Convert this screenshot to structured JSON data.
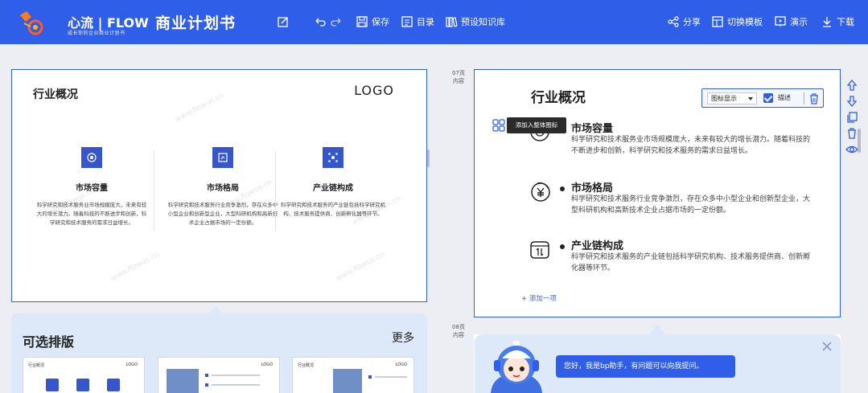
{
  "topbar": {
    "logo_text": "心流 | FLOW",
    "logo_subtitle": "成长你的企业商业计划书",
    "doc_title": "商业计划书",
    "save_label": "保存",
    "toc_label": "目录",
    "knowledge_label": "预设知识库",
    "share_label": "分享",
    "switch_template_label": "切换模板",
    "present_label": "演示",
    "download_label": "下载"
  },
  "left_slide": {
    "title": "行业概况",
    "logo": "LOGO",
    "columns": [
      {
        "heading": "市场容量",
        "text": "科学研究和技术服务业市场规模庞大，未来有较大的增长潜力。随着科技的不断进步和创新，科学研究和技术服务的需求日益增长。"
      },
      {
        "heading": "市场格局",
        "text": "科学研究和技术服务行业竞争激烈，存在众多中小型企业和创新型企业，大型科研机构和高新技术企业占据市场的一定份额。"
      },
      {
        "heading": "产业链构成",
        "text": "科学研究和技术服务的产业链包括科学研究机构、技术服务提供商、创新孵化器等环节。"
      }
    ],
    "watermark": "www.flowus.cn"
  },
  "layout_panel": {
    "title": "可选排版",
    "more_label": "更多",
    "thumbs": [
      {
        "left": "行业概况",
        "right": "LOGO"
      },
      {
        "left": "",
        "right": "LOGO"
      },
      {
        "left": "行业概况",
        "right": "LOGO"
      }
    ]
  },
  "right_slide": {
    "page_label_current": "07页\n内容",
    "page_label_next": "08页\n内容",
    "title": "行业概况",
    "select_value": "图标显示",
    "desc_label": "描述",
    "tooltip": "添加入整体图标",
    "items": [
      {
        "heading": "市场容量",
        "text": "科学研究和技术服务业市场规模庞大，未来有较大的增长潜力。随着科技的不断进步和创新，科学研究和技术服务的需求日益增长。"
      },
      {
        "heading": "市场格局",
        "text": "科学研究和技术服务行业竞争激烈，存在众多中小型企业和创新型企业，大型科研机构和高新技术企业占据市场的一定份额。"
      },
      {
        "heading": "产业链构成",
        "text": "科学研究和技术服务的产业链包括科学研究机构、技术服务提供商、创新孵化器等环节。"
      }
    ],
    "add_label": "+ 添加一项"
  },
  "assistant": {
    "message": "您好，我是bp助手，有问题可以向我提问。"
  },
  "colors": {
    "brand": "#2f5fe8",
    "panel": "#dde9f8",
    "icon_fill": "#3656c9"
  }
}
